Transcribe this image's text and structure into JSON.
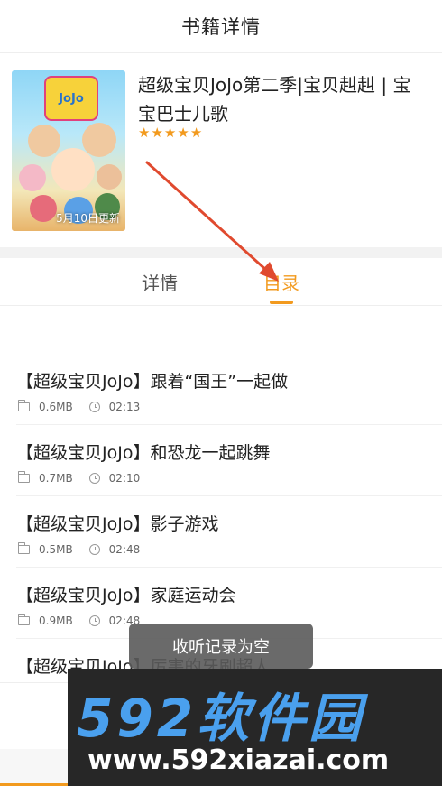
{
  "header": {
    "title": "书籍详情"
  },
  "book": {
    "title": "超级宝贝JoJo第二季|宝贝赳赳 | 宝宝巴士儿歌",
    "rating_stars": 5,
    "cover": {
      "logo_text": "JoJo",
      "update_label": "5月10日更新"
    }
  },
  "tabs": {
    "detail": "详情",
    "catalog": "目录",
    "active": "catalog"
  },
  "episodes": [
    {
      "title": "【超级宝贝JoJo】跟着“国王”一起做",
      "size": "0.6MB",
      "duration": "02:13"
    },
    {
      "title": "【超级宝贝JoJo】和恐龙一起跳舞",
      "size": "0.7MB",
      "duration": "02:10"
    },
    {
      "title": "【超级宝贝JoJo】影子游戏",
      "size": "0.5MB",
      "duration": "02:48"
    },
    {
      "title": "【超级宝贝JoJo】家庭运动会",
      "size": "0.9MB",
      "duration": "02:48"
    },
    {
      "title": "【超级宝贝JoJo】厉害的牙刷超人",
      "size": "",
      "duration": ""
    }
  ],
  "toast": {
    "text": "收听记录为空"
  },
  "watermark": {
    "brand": "592软件园",
    "url": "www.592xiazai.com"
  },
  "colors": {
    "accent": "#f29a1e",
    "annotation_arrow": "#e04a2f",
    "watermark_blue": "#4aa0ee"
  },
  "icons": {
    "size": "folder-icon",
    "duration": "clock-icon",
    "rating": "star-icon"
  }
}
